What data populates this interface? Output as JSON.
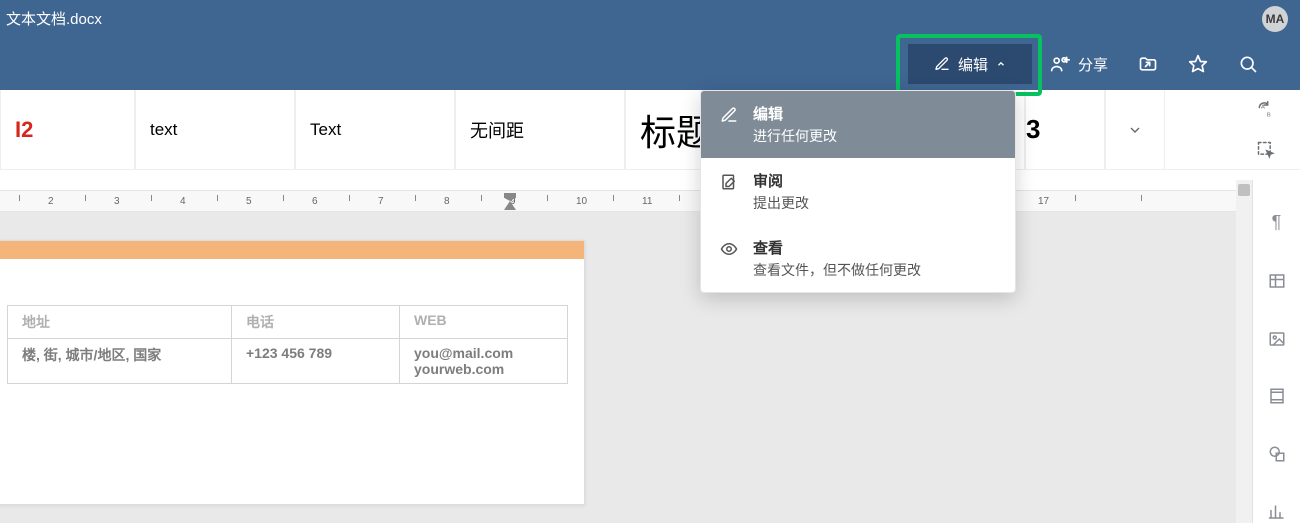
{
  "header": {
    "doc_title": "文本文档.docx",
    "avatar_initials": "MA"
  },
  "toolbar": {
    "edit_label": "编辑",
    "share_label": "分享"
  },
  "styles": {
    "h2": "I2",
    "text1": "text",
    "text2": "Text",
    "nospacing": "无间距",
    "heading": "标题",
    "num3": "3"
  },
  "dropdown": {
    "items": [
      {
        "title": "编辑",
        "desc": "进行任何更改"
      },
      {
        "title": "审阅",
        "desc": "提出更改"
      },
      {
        "title": "查看",
        "desc": "查看文件，但不做任何更改"
      }
    ]
  },
  "document": {
    "table": {
      "headers": {
        "address": "地址",
        "phone": "电话",
        "web": "WEB"
      },
      "values": {
        "address": "楼, 街, 城市/地区, 国家",
        "phone": "+123 456 789",
        "email": "you@mail.com",
        "site": "yourweb.com"
      }
    }
  },
  "ruler": {
    "max": 17
  }
}
